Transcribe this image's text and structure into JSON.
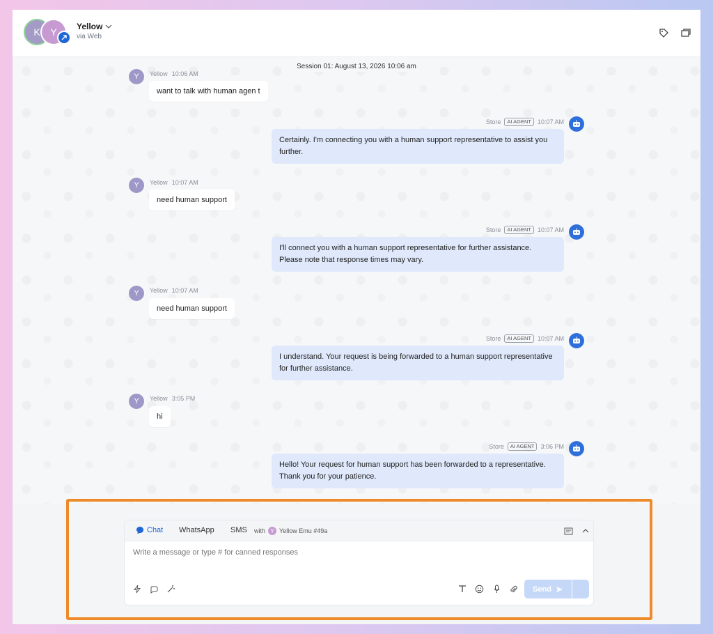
{
  "header": {
    "avatar_k": "K",
    "avatar_y": "Y",
    "contact_name": "Yellow",
    "channel": "via Web",
    "icons": [
      "tag-icon",
      "window-icon",
      "chevron-down-icon"
    ]
  },
  "conversation": {
    "session_label": "Session 01: August 13, 2026 10:06 am",
    "messages": [
      {
        "from": "user",
        "avatar": "Y",
        "sender": "Yellow",
        "time": "10:06 AM",
        "text": "want to talk with human agen t"
      },
      {
        "from": "agent",
        "sender": "Store",
        "badge": "AI AGENT",
        "time": "10:07 AM",
        "text": "Certainly. I'm connecting you with a human support representative to assist you further."
      },
      {
        "from": "user",
        "avatar": "Y",
        "sender": "Yellow",
        "time": "10:07 AM",
        "text": "need human support"
      },
      {
        "from": "agent",
        "sender": "Store",
        "badge": "AI AGENT",
        "time": "10:07 AM",
        "text": "I'll connect you with a human support representative for further assistance. Please note that response times may vary."
      },
      {
        "from": "user",
        "avatar": "Y",
        "sender": "Yellow",
        "time": "10:07 AM",
        "text": "need human support"
      },
      {
        "from": "agent",
        "sender": "Store",
        "badge": "AI AGENT",
        "time": "10:07 AM",
        "text": "I understand. Your request is being forwarded to a human support representative for further assistance."
      },
      {
        "from": "user",
        "avatar": "Y",
        "sender": "Yellow",
        "time": "3:05 PM",
        "text": "hi"
      },
      {
        "from": "agent",
        "sender": "Store",
        "badge": "AI AGENT",
        "time": "3:06 PM",
        "text": "Hello! Your request for human support has been forwarded to a representative. Thank you for your patience."
      }
    ]
  },
  "composer": {
    "tabs": {
      "chat": "Chat",
      "whatsapp": "WhatsApp",
      "sms": "SMS"
    },
    "with_label": "with",
    "with_avatar": "Y",
    "recipient": "Yellow Emu #49a",
    "placeholder": "Write a message or type # for canned responses",
    "send_label": "Send"
  },
  "colors": {
    "accent": "#1f66d6",
    "highlight": "#ef8a2a",
    "agent_bubble": "#dfe9fb"
  }
}
